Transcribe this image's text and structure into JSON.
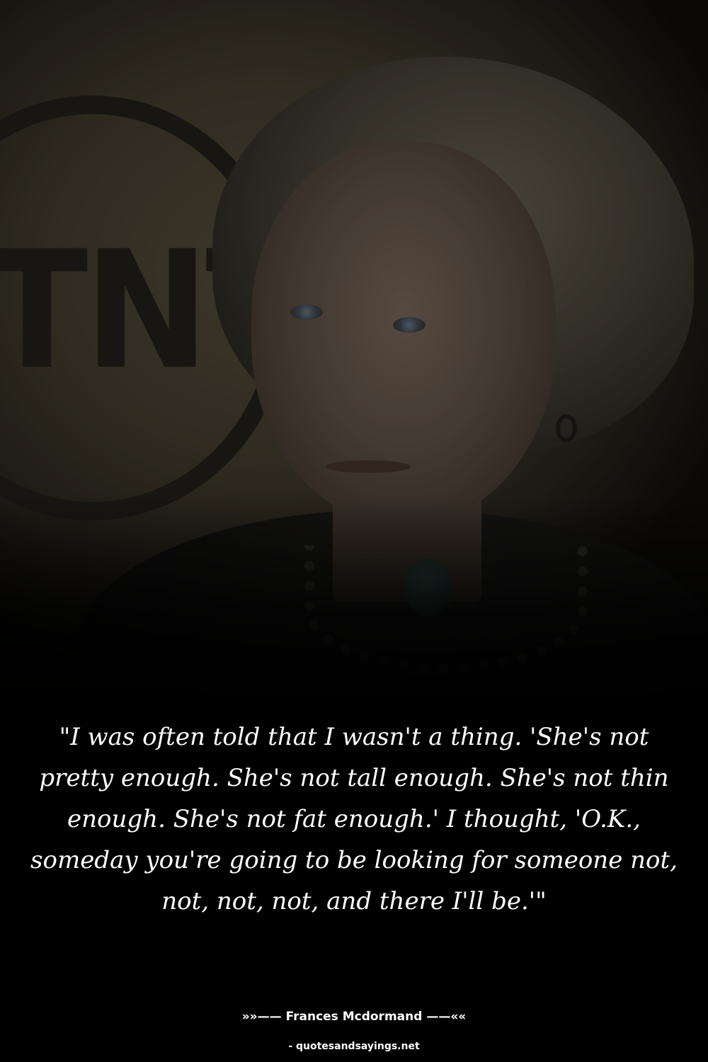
{
  "photo": {
    "logo_text": "TNT",
    "colors": {
      "background": "#3a3528",
      "logo": "#1d1b16",
      "hair": "#5a5448",
      "skin": "#54473d",
      "clothing": "#111110"
    }
  },
  "quote": {
    "text": "\"I was often told that I wasn't a thing. 'She's not pretty enough. She's not tall enough. She's not thin enough. She's not fat enough.' I thought, 'O.K., someday you're going to be looking for someone not, not, not, not, and there I'll be.'\""
  },
  "author": {
    "text": "»»—— Frances Mcdormand ——««"
  },
  "source": {
    "text": "- quotesandsayings.net"
  }
}
